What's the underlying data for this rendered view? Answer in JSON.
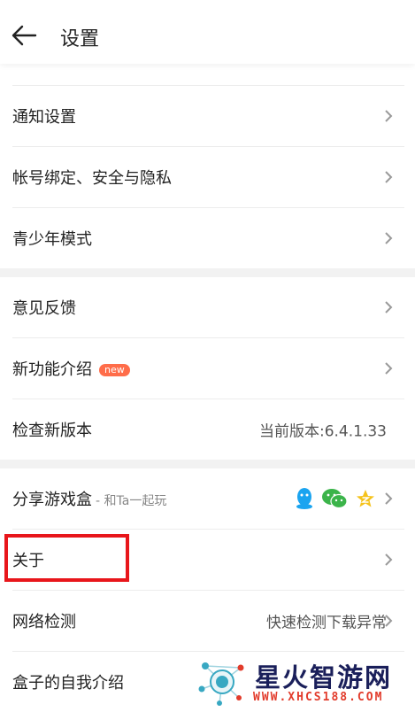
{
  "header": {
    "title": "设置"
  },
  "settings": {
    "notify": "通知设置",
    "account": "帐号绑定、安全与隐私",
    "teen": "青少年模式",
    "feedback": "意见反馈",
    "features": "新功能介绍",
    "features_badge": "new",
    "check_update": "检查新版本",
    "version": "当前版本:6.4.1.33",
    "share": "分享游戏盒",
    "share_sub": "- 和Ta一起玩",
    "share_icons": [
      "qq-icon",
      "wechat-icon",
      "qzone-icon"
    ],
    "about": "关于",
    "network": "网络检测",
    "network_value": "快速检测下载异常",
    "intro": "盒子的自我介绍"
  },
  "watermark": {
    "name": "星火智游网",
    "url": "WWW.XHCS188.COM"
  },
  "colors": {
    "highlight": "#e8161b",
    "badge": "#ff6d4a",
    "qq": "#1aa4f0",
    "wechat": "#3bb44a",
    "qzone": "#f5c21b"
  }
}
